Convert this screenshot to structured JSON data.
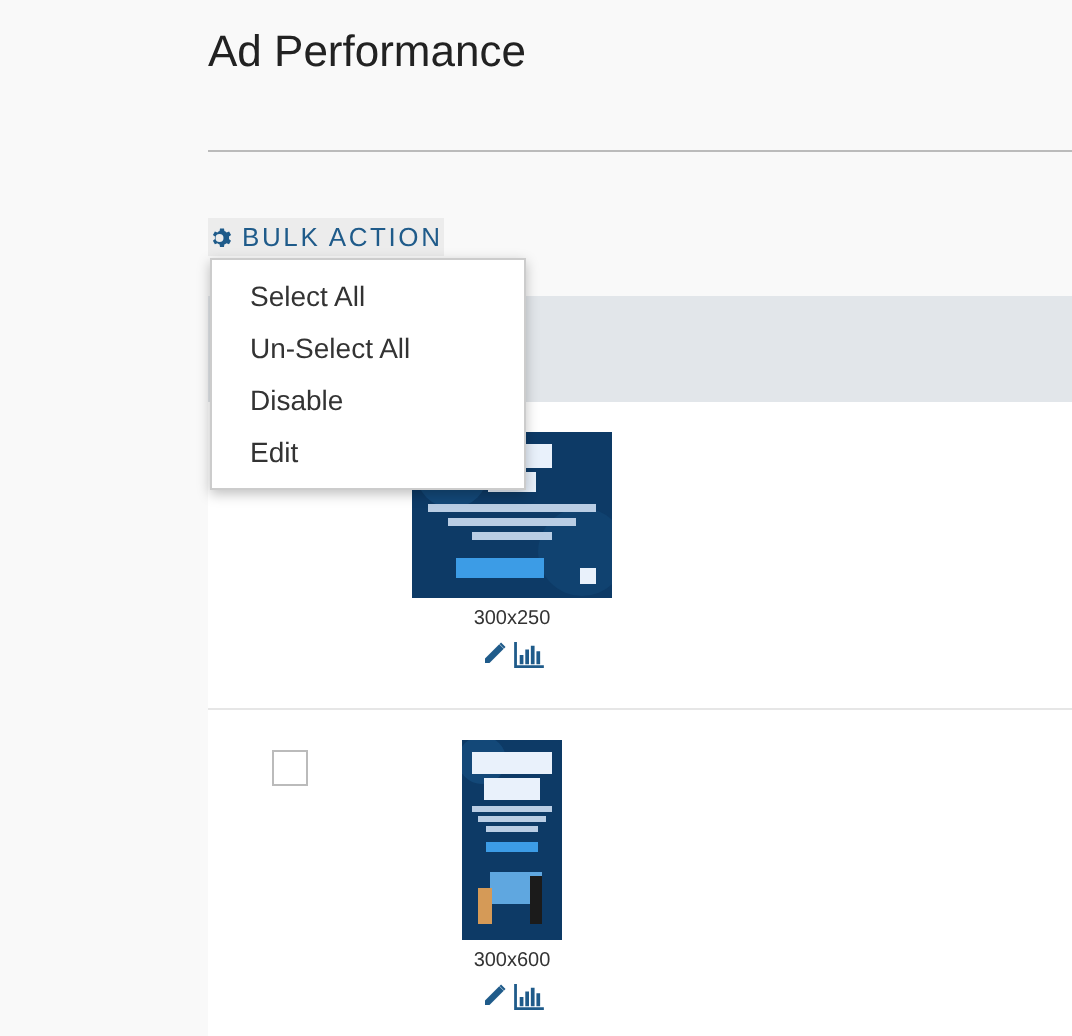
{
  "page": {
    "title": "Ad Performance"
  },
  "bulk_action": {
    "label": "BULK ACTION",
    "menu": [
      {
        "label": "Select All"
      },
      {
        "label": "Un-Select All"
      },
      {
        "label": "Disable"
      },
      {
        "label": "Edit"
      }
    ]
  },
  "ads": [
    {
      "kind": "wide",
      "size": "300x250"
    },
    {
      "kind": "tall",
      "size": "300x600",
      "checked": false
    }
  ]
}
